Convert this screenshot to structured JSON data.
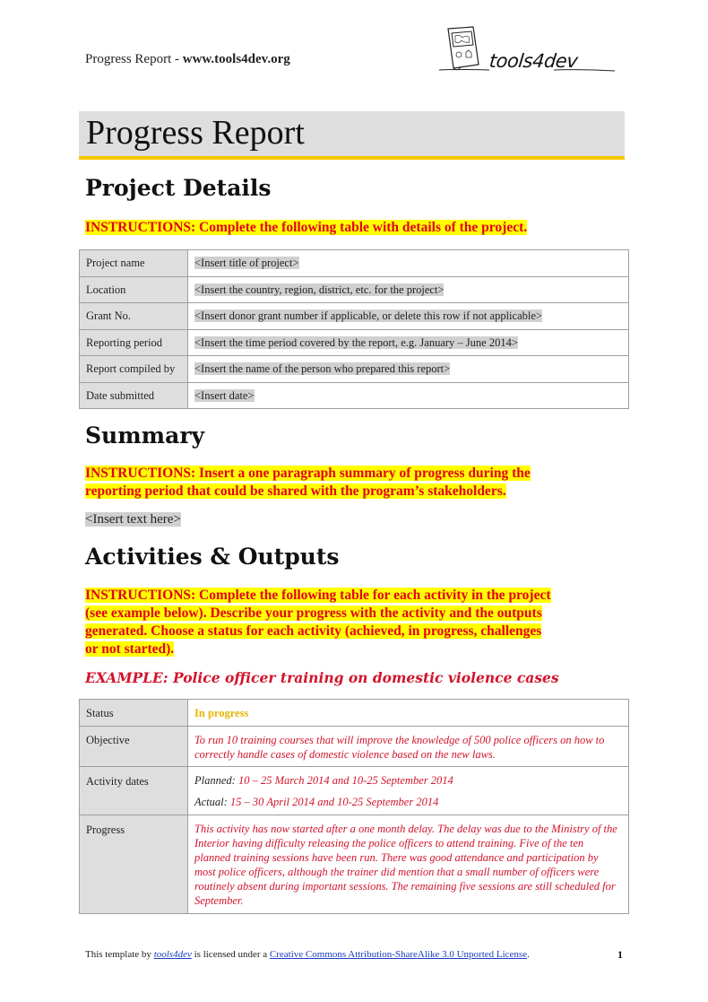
{
  "header": {
    "doc_label": "Progress Report - ",
    "site": "www.tools4dev.org",
    "logo_text": "tools4dev"
  },
  "title": "Progress Report",
  "project_details": {
    "heading": "Project Details",
    "instructions": "INSTRUCTIONS: Complete the following table with details of the project.",
    "rows": [
      {
        "label": "Project name",
        "value": "<Insert title of project>"
      },
      {
        "label": "Location",
        "value": "<Insert the country, region, district, etc. for the project>"
      },
      {
        "label": "Grant No.",
        "value": "<Insert donor grant number if applicable, or delete this row if not applicable>"
      },
      {
        "label": "Reporting period",
        "value": "<Insert the time period covered by the report, e.g. January – June 2014>"
      },
      {
        "label": "Report compiled by",
        "value": "<Insert the name of the person who prepared this report>"
      },
      {
        "label": "Date submitted",
        "value": "<Insert date>"
      }
    ]
  },
  "summary": {
    "heading": "Summary",
    "instructions_line1": "INSTRUCTIONS: Insert a one paragraph summary of progress during the",
    "instructions_line2": "reporting period that could be shared with the program’s stakeholders.",
    "placeholder": "<Insert text here>"
  },
  "activities": {
    "heading": "Activities & Outputs",
    "instructions_lines": [
      "INSTRUCTIONS: Complete the following table for each activity in the project",
      "(see example below). Describe your progress with the activity and the outputs",
      "generated. Choose a status for each activity (achieved, in progress, challenges",
      "or not started)."
    ],
    "example_title": "EXAMPLE: Police officer training on domestic violence cases",
    "table": {
      "status_label": "Status",
      "status_value": "In progress",
      "objective_label": "Objective",
      "objective_value": "To run 10 training courses that will improve the knowledge of 500 police officers on how to correctly handle cases of domestic violence based on the new laws.",
      "dates_label": "Activity dates",
      "planned_label": "Planned:",
      "planned_value": "10 – 25 March 2014 and 10-25 September 2014",
      "actual_label": "Actual:",
      "actual_value": "15 – 30 April 2014 and 10-25 September 2014",
      "progress_label": "Progress",
      "progress_value": "This activity has now started after a one month delay. The delay was due to the Ministry of the Interior having difficulty releasing the police officers to attend training.  Five of the ten planned training sessions have been run. There was good attendance and participation by most police officers, although the trainer did mention that a small number of officers were routinely absent during important sessions. The remaining five sessions are still scheduled for September."
    }
  },
  "footer": {
    "prefix": "This template by ",
    "author_link": "tools4dev",
    "middle": " is licensed under a ",
    "license_link": "Creative Commons Attribution-ShareAlike 3.0 Unported License",
    "suffix": ".",
    "page_number": "1"
  },
  "colors": {
    "accent_yellow": "#f6c800",
    "highlight": "#ffff00",
    "instruction_red": "#e3001b",
    "example_red": "#d0142c",
    "status_in_progress": "#e8b400",
    "link_blue": "#1a3dbb"
  }
}
